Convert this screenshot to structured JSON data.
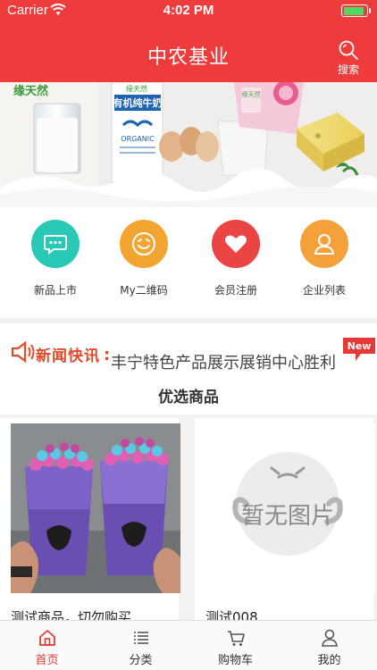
{
  "status_bar": {
    "carrier": "Carrier",
    "time": "4:02 PM",
    "battery_level": 0.9
  },
  "header": {
    "title": "中农基业",
    "search_label": "搜索"
  },
  "banner": {
    "brand_text": "缘天然",
    "carton_brand": "缘天然",
    "carton_title": "有机纯牛奶",
    "carton_organic": "ORGANIC",
    "box_text": "缘天然"
  },
  "entries": [
    {
      "label": "新品上市",
      "icon": "chat-bubble-icon",
      "color": "#29c9b5"
    },
    {
      "label": "My二维码",
      "icon": "smiley-icon",
      "color": "#f3a531"
    },
    {
      "label": "会员注册",
      "icon": "heart-icon",
      "color": "#ea4443"
    },
    {
      "label": "企业列表",
      "icon": "person-icon",
      "color": "#f4a13c"
    }
  ],
  "news": {
    "title": "新闻快讯",
    "ticker_text": "丰宁特色产品展示展销中心胜利",
    "badge": "New"
  },
  "section_title": "优选商品",
  "products": [
    {
      "name": "测试商品，切勿购买",
      "image": "bubble-tea-photo"
    },
    {
      "name": "测试008",
      "image": "no-image-placeholder",
      "placeholder_text": "暂无图片"
    }
  ],
  "tabbar": [
    {
      "label": "首页",
      "icon": "home-icon",
      "active": true
    },
    {
      "label": "分类",
      "icon": "list-icon",
      "active": false
    },
    {
      "label": "购物车",
      "icon": "cart-icon",
      "active": false
    },
    {
      "label": "我的",
      "icon": "user-icon",
      "active": false
    }
  ],
  "colors": {
    "primary": "#ee3b3b",
    "active_tab": "#e53935"
  }
}
